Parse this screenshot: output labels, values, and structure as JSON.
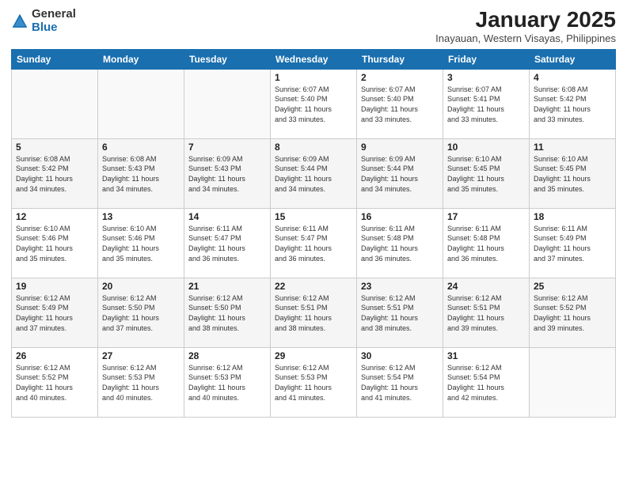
{
  "logo": {
    "general": "General",
    "blue": "Blue"
  },
  "header": {
    "month": "January 2025",
    "location": "Inayauan, Western Visayas, Philippines"
  },
  "weekdays": [
    "Sunday",
    "Monday",
    "Tuesday",
    "Wednesday",
    "Thursday",
    "Friday",
    "Saturday"
  ],
  "weeks": [
    [
      {
        "day": "",
        "info": ""
      },
      {
        "day": "",
        "info": ""
      },
      {
        "day": "",
        "info": ""
      },
      {
        "day": "1",
        "info": "Sunrise: 6:07 AM\nSunset: 5:40 PM\nDaylight: 11 hours\nand 33 minutes."
      },
      {
        "day": "2",
        "info": "Sunrise: 6:07 AM\nSunset: 5:40 PM\nDaylight: 11 hours\nand 33 minutes."
      },
      {
        "day": "3",
        "info": "Sunrise: 6:07 AM\nSunset: 5:41 PM\nDaylight: 11 hours\nand 33 minutes."
      },
      {
        "day": "4",
        "info": "Sunrise: 6:08 AM\nSunset: 5:42 PM\nDaylight: 11 hours\nand 33 minutes."
      }
    ],
    [
      {
        "day": "5",
        "info": "Sunrise: 6:08 AM\nSunset: 5:42 PM\nDaylight: 11 hours\nand 34 minutes."
      },
      {
        "day": "6",
        "info": "Sunrise: 6:08 AM\nSunset: 5:43 PM\nDaylight: 11 hours\nand 34 minutes."
      },
      {
        "day": "7",
        "info": "Sunrise: 6:09 AM\nSunset: 5:43 PM\nDaylight: 11 hours\nand 34 minutes."
      },
      {
        "day": "8",
        "info": "Sunrise: 6:09 AM\nSunset: 5:44 PM\nDaylight: 11 hours\nand 34 minutes."
      },
      {
        "day": "9",
        "info": "Sunrise: 6:09 AM\nSunset: 5:44 PM\nDaylight: 11 hours\nand 34 minutes."
      },
      {
        "day": "10",
        "info": "Sunrise: 6:10 AM\nSunset: 5:45 PM\nDaylight: 11 hours\nand 35 minutes."
      },
      {
        "day": "11",
        "info": "Sunrise: 6:10 AM\nSunset: 5:45 PM\nDaylight: 11 hours\nand 35 minutes."
      }
    ],
    [
      {
        "day": "12",
        "info": "Sunrise: 6:10 AM\nSunset: 5:46 PM\nDaylight: 11 hours\nand 35 minutes."
      },
      {
        "day": "13",
        "info": "Sunrise: 6:10 AM\nSunset: 5:46 PM\nDaylight: 11 hours\nand 35 minutes."
      },
      {
        "day": "14",
        "info": "Sunrise: 6:11 AM\nSunset: 5:47 PM\nDaylight: 11 hours\nand 36 minutes."
      },
      {
        "day": "15",
        "info": "Sunrise: 6:11 AM\nSunset: 5:47 PM\nDaylight: 11 hours\nand 36 minutes."
      },
      {
        "day": "16",
        "info": "Sunrise: 6:11 AM\nSunset: 5:48 PM\nDaylight: 11 hours\nand 36 minutes."
      },
      {
        "day": "17",
        "info": "Sunrise: 6:11 AM\nSunset: 5:48 PM\nDaylight: 11 hours\nand 36 minutes."
      },
      {
        "day": "18",
        "info": "Sunrise: 6:11 AM\nSunset: 5:49 PM\nDaylight: 11 hours\nand 37 minutes."
      }
    ],
    [
      {
        "day": "19",
        "info": "Sunrise: 6:12 AM\nSunset: 5:49 PM\nDaylight: 11 hours\nand 37 minutes."
      },
      {
        "day": "20",
        "info": "Sunrise: 6:12 AM\nSunset: 5:50 PM\nDaylight: 11 hours\nand 37 minutes."
      },
      {
        "day": "21",
        "info": "Sunrise: 6:12 AM\nSunset: 5:50 PM\nDaylight: 11 hours\nand 38 minutes."
      },
      {
        "day": "22",
        "info": "Sunrise: 6:12 AM\nSunset: 5:51 PM\nDaylight: 11 hours\nand 38 minutes."
      },
      {
        "day": "23",
        "info": "Sunrise: 6:12 AM\nSunset: 5:51 PM\nDaylight: 11 hours\nand 38 minutes."
      },
      {
        "day": "24",
        "info": "Sunrise: 6:12 AM\nSunset: 5:51 PM\nDaylight: 11 hours\nand 39 minutes."
      },
      {
        "day": "25",
        "info": "Sunrise: 6:12 AM\nSunset: 5:52 PM\nDaylight: 11 hours\nand 39 minutes."
      }
    ],
    [
      {
        "day": "26",
        "info": "Sunrise: 6:12 AM\nSunset: 5:52 PM\nDaylight: 11 hours\nand 40 minutes."
      },
      {
        "day": "27",
        "info": "Sunrise: 6:12 AM\nSunset: 5:53 PM\nDaylight: 11 hours\nand 40 minutes."
      },
      {
        "day": "28",
        "info": "Sunrise: 6:12 AM\nSunset: 5:53 PM\nDaylight: 11 hours\nand 40 minutes."
      },
      {
        "day": "29",
        "info": "Sunrise: 6:12 AM\nSunset: 5:53 PM\nDaylight: 11 hours\nand 41 minutes."
      },
      {
        "day": "30",
        "info": "Sunrise: 6:12 AM\nSunset: 5:54 PM\nDaylight: 11 hours\nand 41 minutes."
      },
      {
        "day": "31",
        "info": "Sunrise: 6:12 AM\nSunset: 5:54 PM\nDaylight: 11 hours\nand 42 minutes."
      },
      {
        "day": "",
        "info": ""
      }
    ]
  ]
}
